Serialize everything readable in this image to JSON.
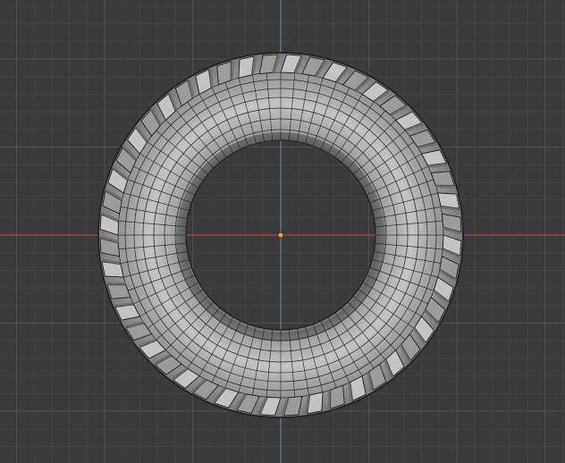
{
  "viewport": {
    "view": "top-orthographic",
    "background_color": "#3a3a3a",
    "grid": {
      "visible": true,
      "minor_color": "#434343",
      "major_color": "#4e4e4e"
    },
    "axes": {
      "x_axis_color": "#a5454d",
      "y_axis_color": "#4f80b0"
    },
    "origin_marker_color": "#f2a230"
  },
  "object": {
    "type": "tire-torus-mesh",
    "face_color": "#9b9b9b",
    "face_highlight_color": "#c4c4c4",
    "edge_color": "#1f1f1f",
    "tread_shadow_color": "#6a6a6a",
    "radial_segments": 72,
    "tread_blocks": 48
  }
}
